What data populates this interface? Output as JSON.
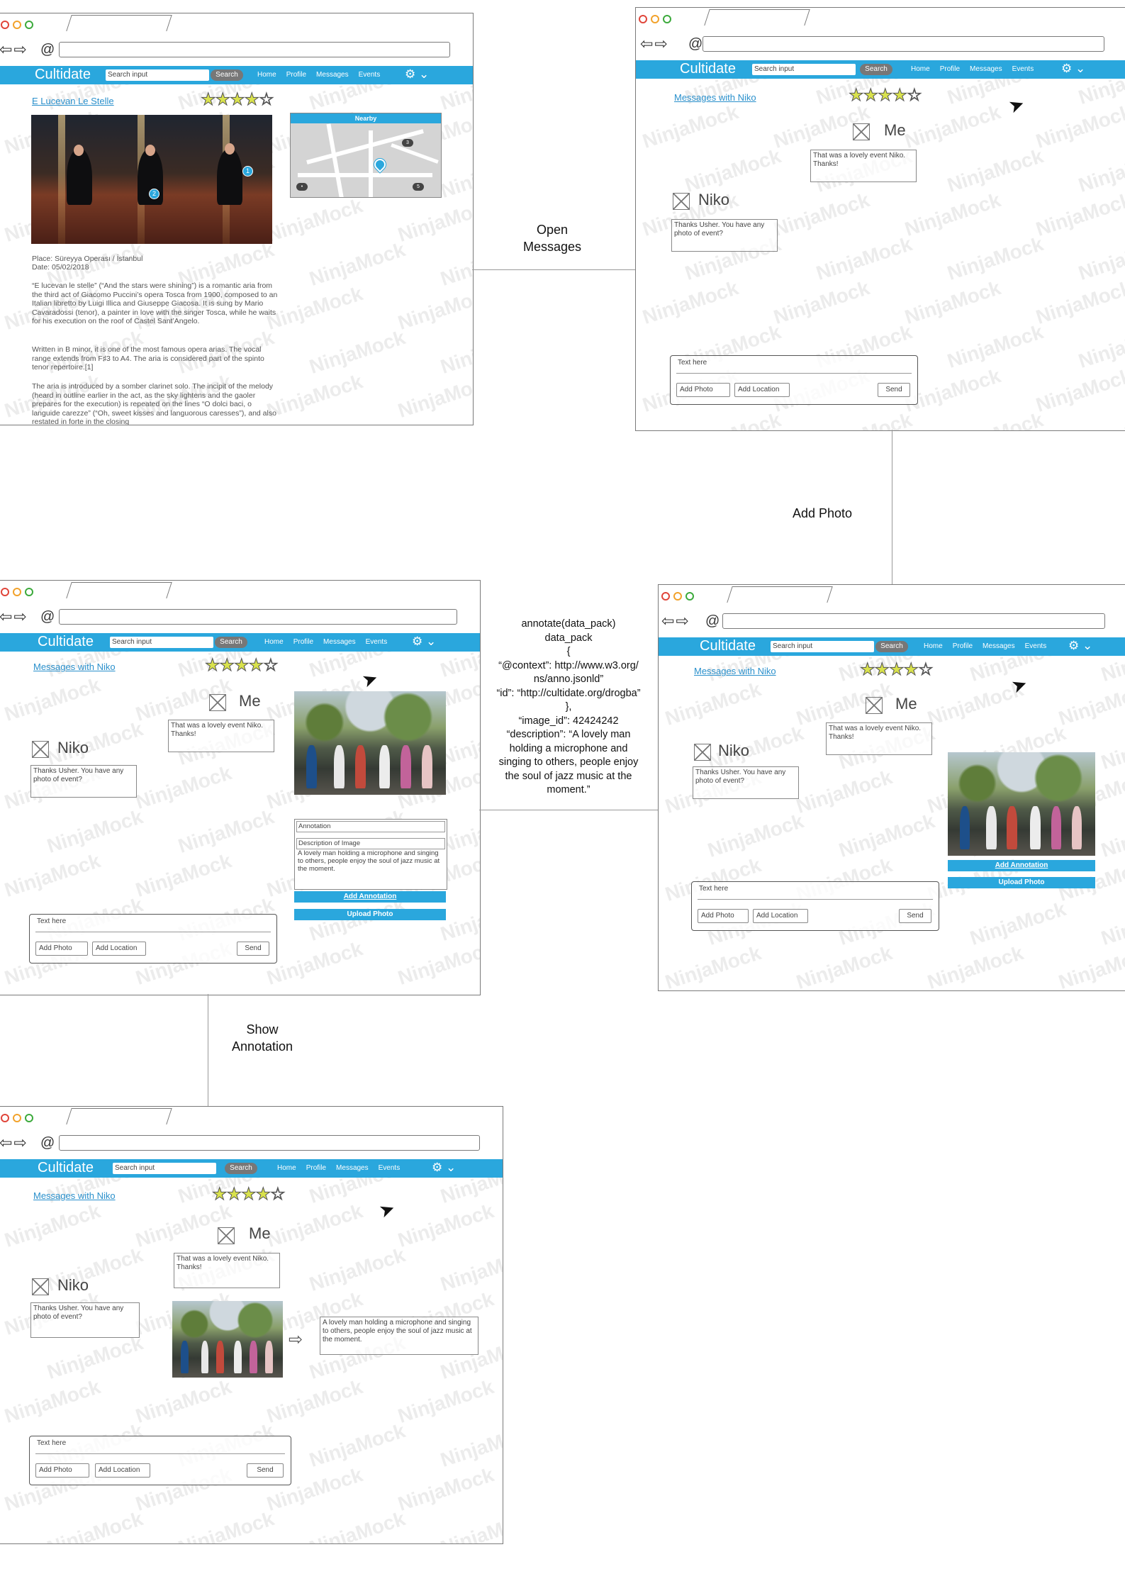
{
  "browser": {
    "app_name": "Cultidate",
    "search_placeholder": "Search input",
    "search_button": "Search",
    "nav": [
      "Home",
      "Profile",
      "Messages",
      "Events"
    ]
  },
  "flow_labels": {
    "open_messages": "Open\nMessages",
    "add_photo": "Add Photo",
    "show_annotation": "Show\nAnnotation"
  },
  "annotate_code": "annotate(data_pack)\ndata_pack\n{\n“@context”: http://www.w3.org/\nns/anno.jsonld”\n“id”: “http://cultidate.org/drogba”\n},\n“image_id”: 42424242\n“description”: “A lovely man\nholding a microphone and\nsinging to others, people enjoy\nthe soul of jazz music at the\nmoment.”",
  "watermark": "NinjaMock",
  "event_page": {
    "title_part1": "E Lucevan",
    "title_part2": "Le Stelle",
    "rating": 4,
    "nearby_label": "Nearby",
    "map_markers": [
      "3",
      "5",
      "•"
    ],
    "photo_markers": [
      "1",
      "2"
    ],
    "place": "Place: Süreyya Operası / İstanbul",
    "date": "Date: 05/02/2018",
    "paragraphs": [
      "“E lucevan le stelle” (“And the stars were shining”) is a romantic aria from the third act of Giacomo Puccini’s opera Tosca from 1900, composed to an Italian libretto by Luigi Illica and Giuseppe Giacosa. It is sung by Mario Cavaradossi (tenor), a painter in love with the singer Tosca, while he waits for his execution on the roof of Castel Sant’Angelo.",
      "Written in B minor, it is one of the most famous opera arias. The vocal range extends from F♯3 to A4. The aria is considered part of the spinto tenor repertoire.[1]",
      "The aria is introduced by a somber clarinet solo. The incipit of the melody (heard in outline earlier in the act, as the sky lightens and the gaoler prepares for the execution) is repeated on the lines “O dolci baci, o languide carezze” (“Oh, sweet kisses and languorous caresses”), and also restated in forte in the closing"
    ]
  },
  "chat": {
    "title": "Messages with Niko",
    "rating": 4,
    "me_name": "Me",
    "niko_name": "Niko",
    "me_message": "That was a lovely event Niko. Thanks!",
    "niko_message": "Thanks Usher. You have any photo of event?",
    "composer_placeholder": "Text here",
    "add_photo_button": "Add Photo",
    "add_location_button": "Add Location",
    "send_button": "Send",
    "add_annotation_button": "Add Annotation",
    "upload_photo_button": "Upload Photo",
    "annotation_header": "Annotation",
    "description_header": "Description of Image",
    "annotation_text": "A lovely man holding a microphone and singing to others, people enjoy the soul of jazz music at the moment."
  },
  "colors": {
    "accent": "#2aa7dd",
    "star_fill": "#d9e24c"
  }
}
